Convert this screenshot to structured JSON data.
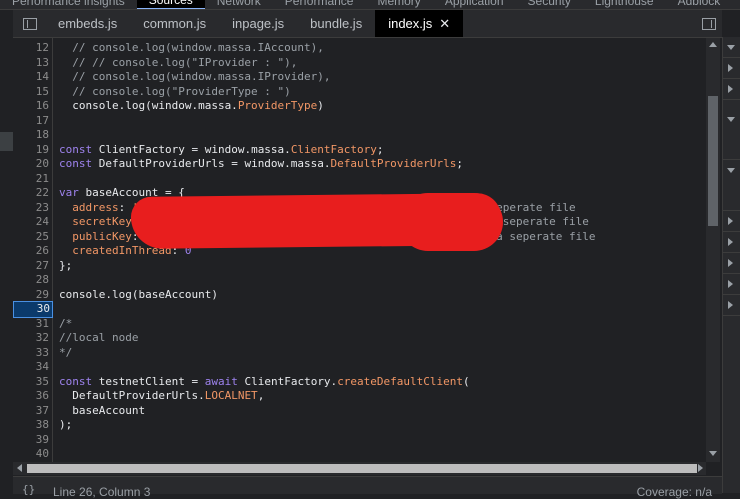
{
  "devtools": {
    "tabs": [
      "Performance insights",
      "Sources",
      "Network",
      "Performance",
      "Memory",
      "Application",
      "Security",
      "Lighthouse",
      "Adblock"
    ],
    "active_tab": "Sources"
  },
  "editor": {
    "open_files": [
      "embeds.js",
      "common.js",
      "inpage.js",
      "bundle.js",
      "index.js"
    ],
    "active_file": "index.js",
    "close_glyph": "✕",
    "current_line": 30,
    "lines": [
      {
        "n": "12",
        "t": "  // console.log(window.massa.IAccount),"
      },
      {
        "n": "13",
        "t": "  // // console.log(\"IProvider : \"),"
      },
      {
        "n": "14",
        "t": "  // console.log(window.massa.IProvider),"
      },
      {
        "n": "15",
        "t": "  // console.log(\"ProviderType : \")"
      },
      {
        "n": "16",
        "t": "  console.log(window.massa.ProviderType)"
      },
      {
        "n": "17",
        "t": ""
      },
      {
        "n": "18",
        "t": ""
      },
      {
        "n": "19",
        "t": "const ClientFactory = window.massa.ClientFactory;"
      },
      {
        "n": "20",
        "t": "const DefaultProviderUrls = window.massa.DefaultProviderUrls;"
      },
      {
        "n": "21",
        "t": ""
      },
      {
        "n": "22",
        "t": "var baseAccount = {"
      },
      {
        "n": "23",
        "t": "  address: '                                  ', //todo put in a seperate file"
      },
      {
        "n": "24",
        "t": "  secretKey:                                    ', //todo put in a seperate file"
      },
      {
        "n": "25",
        "t": "  publicKey:                                      , //todo put in a seperate file"
      },
      {
        "n": "26",
        "t": "  createdInThread: 0"
      },
      {
        "n": "27",
        "t": "};"
      },
      {
        "n": "28",
        "t": ""
      },
      {
        "n": "29",
        "t": "console.log(baseAccount)"
      },
      {
        "n": "30",
        "t": ""
      },
      {
        "n": "31",
        "t": "/*"
      },
      {
        "n": "32",
        "t": "//local node"
      },
      {
        "n": "33",
        "t": "*/"
      },
      {
        "n": "34",
        "t": ""
      },
      {
        "n": "35",
        "t": "const testnetClient = await ClientFactory.createDefaultClient("
      },
      {
        "n": "36",
        "t": "  DefaultProviderUrls.LOCALNET,"
      },
      {
        "n": "37",
        "t": "  baseAccount"
      },
      {
        "n": "38",
        "t": ");"
      },
      {
        "n": "39",
        "t": ""
      },
      {
        "n": "40",
        "t": ""
      }
    ]
  },
  "statusbar": {
    "braces": "{}",
    "position": "Line 26, Column 3",
    "coverage": "Coverage: n/a"
  },
  "colors": {
    "redaction": "#e81e1e",
    "keyword": "#9e83ee",
    "property": "#f29766"
  }
}
